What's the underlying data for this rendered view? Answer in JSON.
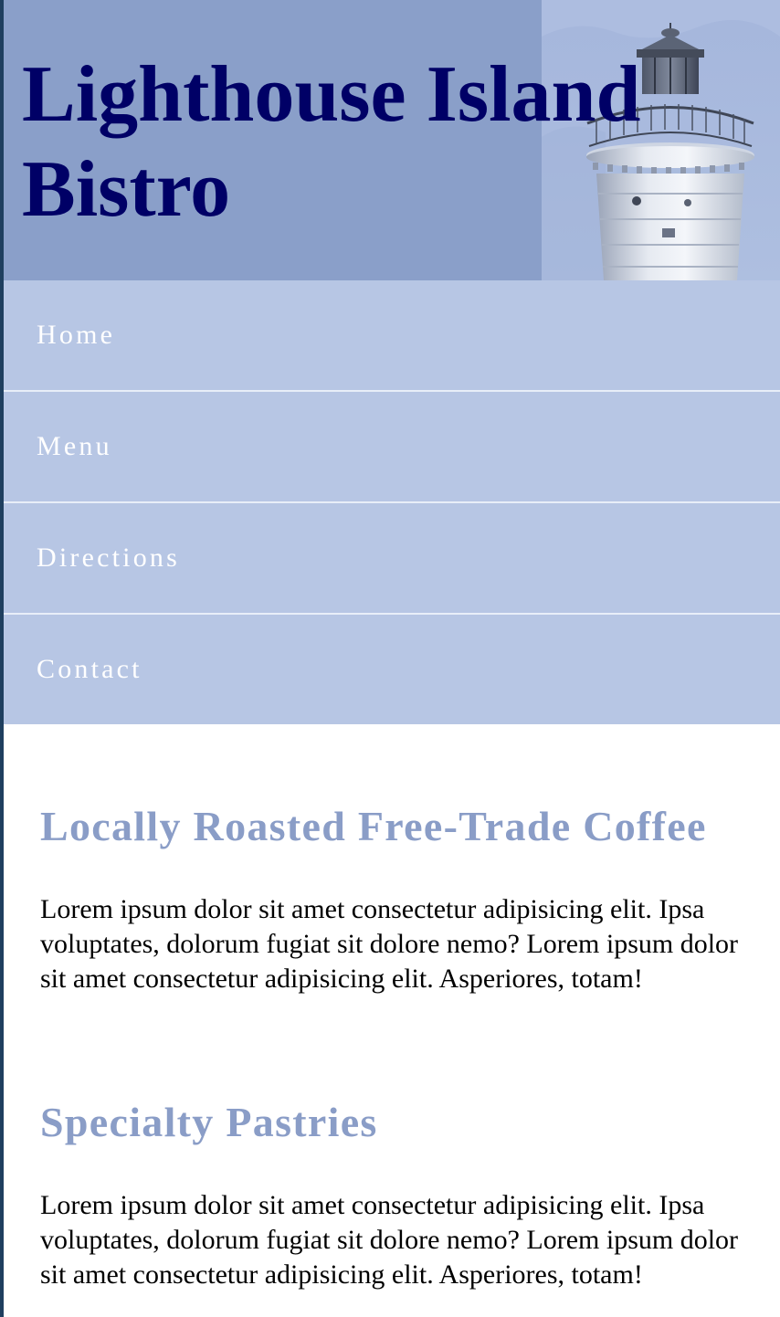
{
  "site": {
    "title": "Lighthouse Island Bistro"
  },
  "nav": {
    "items": [
      {
        "label": "Home"
      },
      {
        "label": "Menu"
      },
      {
        "label": "Directions"
      },
      {
        "label": "Contact"
      }
    ]
  },
  "sections": [
    {
      "heading": "Locally Roasted Free-Trade Coffee",
      "body": "Lorem ipsum dolor sit amet consectetur adipisicing elit. Ipsa voluptates, dolorum fugiat sit dolore nemo? Lorem ipsum dolor sit amet consectetur adipisicing elit. Asperiores, totam!"
    },
    {
      "heading": "Specialty Pastries",
      "body": "Lorem ipsum dolor sit amet consectetur adipisicing elit. Ipsa voluptates, dolorum fugiat sit dolore nemo? Lorem ipsum dolor sit amet consectetur adipisicing elit. Asperiores, totam!"
    }
  ],
  "colors": {
    "banner_bg": "#8a9fc9",
    "title_text": "#000066",
    "nav_bg": "#b7c6e4",
    "nav_text": "#ffffff",
    "heading_text": "#8a9dc7",
    "left_border": "#1f3f5f"
  }
}
